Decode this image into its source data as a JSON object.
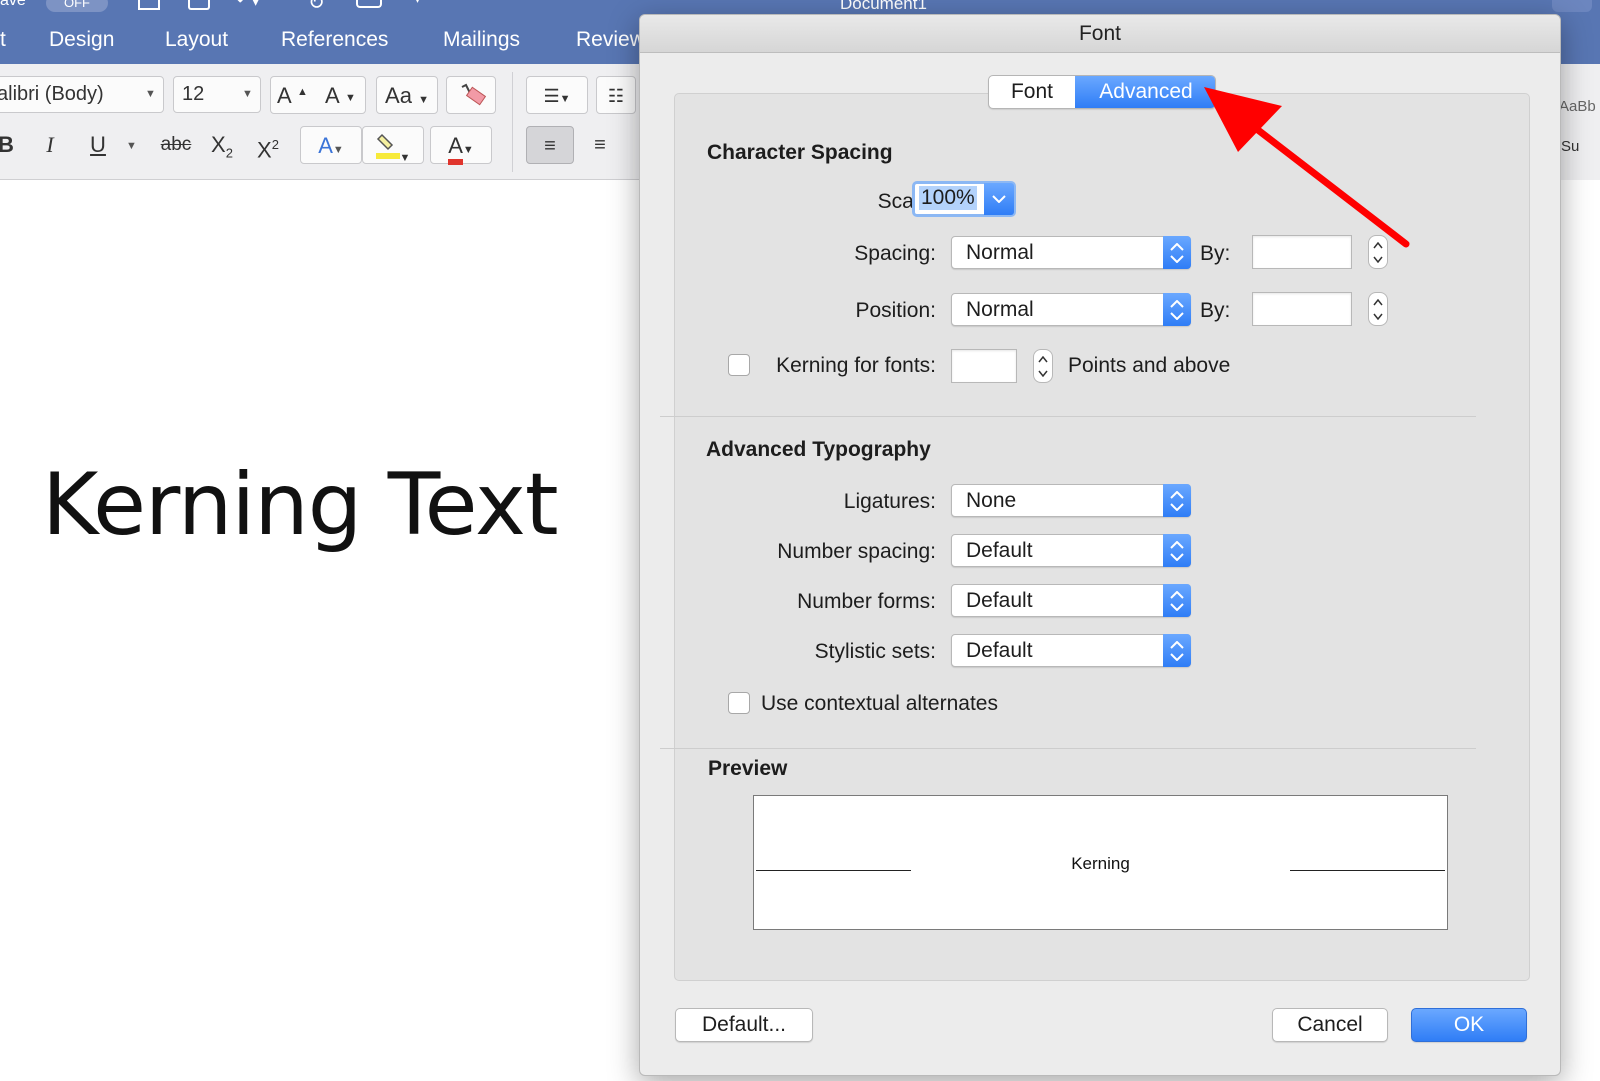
{
  "window": {
    "quick_access": {
      "autosave": "ave",
      "toggle": "OFF"
    },
    "doc_title": "Document1",
    "ribbon_tabs": [
      "t",
      "Design",
      "Layout",
      "References",
      "Mailings",
      "Review"
    ]
  },
  "ribbon": {
    "font_name": "alibri (Body)",
    "font_size": "12",
    "buttons": {
      "grow_font": "A",
      "shrink_font": "A",
      "change_case": "Aa",
      "bold": "B",
      "italic": "I",
      "underline": "U",
      "strikethrough": "abc",
      "subscript": "X",
      "superscript": "X",
      "text_effects": "A",
      "font_color": "A"
    },
    "styles_preview": "AaBb",
    "styles_preview2": "Su"
  },
  "document": {
    "text": "Kerning Text"
  },
  "dialog": {
    "title": "Font",
    "tabs": [
      {
        "label": "Font",
        "selected": false
      },
      {
        "label": "Advanced",
        "selected": true
      }
    ],
    "character_spacing": {
      "title": "Character Spacing",
      "scale_label": "Scale:",
      "scale_value": "100%",
      "spacing_label": "Spacing:",
      "spacing_value": "Normal",
      "position_label": "Position:",
      "position_value": "Normal",
      "by_label": "By:",
      "kerning_label": "Kerning for fonts:",
      "kerning_checked": false,
      "points_label": "Points and above"
    },
    "advanced_typography": {
      "title": "Advanced Typography",
      "ligatures_label": "Ligatures:",
      "ligatures_value": "None",
      "number_spacing_label": "Number spacing:",
      "number_spacing_value": "Default",
      "number_forms_label": "Number forms:",
      "number_forms_value": "Default",
      "stylistic_sets_label": "Stylistic sets:",
      "stylistic_sets_value": "Default",
      "contextual_label": "Use contextual alternates",
      "contextual_checked": false
    },
    "preview": {
      "title": "Preview",
      "text": "Kerning"
    },
    "buttons": {
      "default": "Default...",
      "cancel": "Cancel",
      "ok": "OK"
    }
  },
  "colors": {
    "accent": "#2f7df6",
    "ribbon": "#5876b3",
    "annotation_arrow": "#ff0000"
  },
  "icons": [
    "chevron-updown-icon",
    "chevron-down-icon",
    "annotation-arrow-icon"
  ]
}
